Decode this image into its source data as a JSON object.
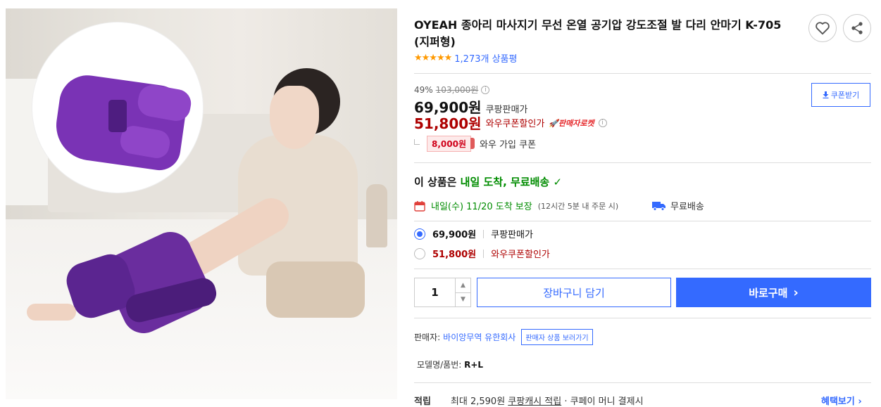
{
  "product": {
    "title": "OYEAH 종아리 마사지기 무선 온열 공기압 강도조절 발 다리 안마기 K-705 (지퍼형)",
    "stars": "★★★★★",
    "review_count": "1,273개 상품평"
  },
  "price": {
    "discount_rate": "49%",
    "original": "103,000원",
    "sale": "69,900원",
    "sale_label": "쿠팡판매가",
    "wow": "51,800원",
    "wow_label": "와우쿠폰할인가",
    "rocket_badge": "판매자로켓",
    "coupon_amount": "8,000원",
    "coupon_label": "와우 가입 쿠폰",
    "coupon_button": "쿠폰받기"
  },
  "delivery": {
    "head_prefix": "이 상품은 ",
    "head_highlight": "내일 도착, 무료배송",
    "check": "✓",
    "arrival": "내일(수) 11/20 도착 보장",
    "arrival_note": "(12시간 5분 내 주문 시)",
    "free_shipping": "무료배송"
  },
  "options": [
    {
      "amount": "69,900원",
      "label": "쿠팡판매가",
      "selected": true
    },
    {
      "amount": "51,800원",
      "label": "와우쿠폰할인가",
      "selected": false
    }
  ],
  "purchase": {
    "quantity": "1",
    "cart_label": "장바구니 담기",
    "buy_label": "바로구매",
    "buy_arrow": "›"
  },
  "seller": {
    "label": "판매자:",
    "name": "바이앙무역 유한회사",
    "shop_link": "판매자 상품 보러가기"
  },
  "model": {
    "label": "모델명/품번:",
    "value": "R+L"
  },
  "points": {
    "label": "적립",
    "text_prefix": "최대 2,590원",
    "text_link": "쿠팡캐시 적립",
    "text_suffix": "· 쿠페이 머니 결제시",
    "benefit": "혜택보기 ›"
  },
  "colors": {
    "accent": "#346aff",
    "wow_red": "#ae0000",
    "green": "#008c00"
  }
}
